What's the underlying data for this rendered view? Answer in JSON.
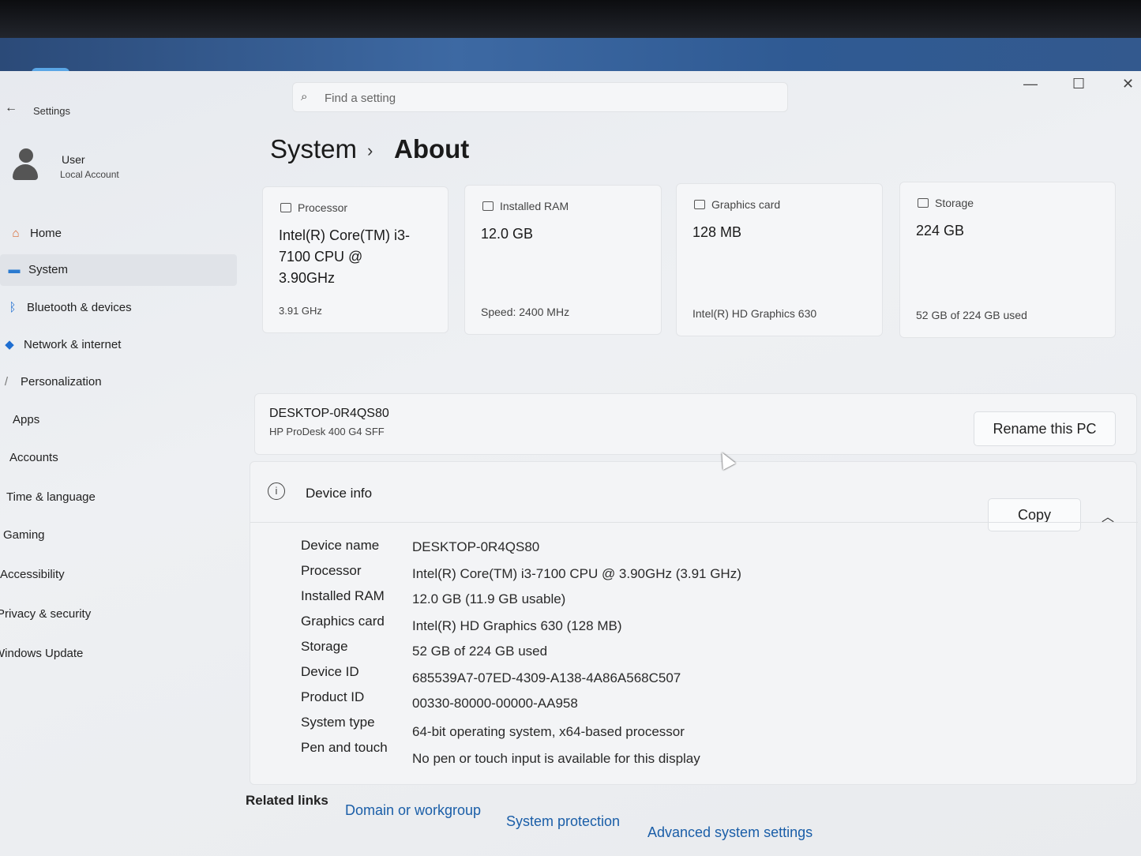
{
  "window": {
    "app_title": "Settings",
    "search_placeholder": "Find a setting",
    "minimize": "—",
    "maximize": "☐",
    "close": "✕"
  },
  "user": {
    "name": "User",
    "account_type": "Local Account"
  },
  "sidebar": {
    "items": [
      {
        "label": "Home",
        "icon": "home-icon"
      },
      {
        "label": "System",
        "icon": "monitor-icon",
        "active": true
      },
      {
        "label": "Bluetooth & devices",
        "icon": "bluetooth-icon"
      },
      {
        "label": "Network & internet",
        "icon": "wifi-icon"
      },
      {
        "label": "Personalization",
        "icon": "brush-icon"
      },
      {
        "label": "Apps",
        "icon": "apps-icon"
      },
      {
        "label": "Accounts",
        "icon": "accounts-icon"
      },
      {
        "label": "Time & language",
        "icon": "clock-icon"
      },
      {
        "label": "Gaming",
        "icon": "gaming-icon"
      },
      {
        "label": "Accessibility",
        "icon": "accessibility-icon"
      },
      {
        "label": "Privacy & security",
        "icon": "shield-icon"
      },
      {
        "label": "Windows Update",
        "icon": "update-icon"
      }
    ]
  },
  "breadcrumb": {
    "parent": "System",
    "separator": "›",
    "current": "About"
  },
  "cards": [
    {
      "label": "Processor",
      "value": "Intel(R) Core(TM) i3-7100 CPU @ 3.90GHz",
      "sub": "3.91 GHz"
    },
    {
      "label": "Installed RAM",
      "value": "12.0 GB",
      "sub": "Speed: 2400 MHz"
    },
    {
      "label": "Graphics card",
      "value": "128 MB",
      "sub": "Intel(R) HD Graphics 630"
    },
    {
      "label": "Storage",
      "value": "224 GB",
      "sub": "52 GB of 224 GB used"
    }
  ],
  "pc": {
    "name": "DESKTOP-0R4QS80",
    "model": "HP ProDesk 400 G4 SFF",
    "rename_label": "Rename this PC"
  },
  "device_info": {
    "title": "Device info",
    "copy_label": "Copy",
    "collapse_icon": "chevron-up-icon",
    "specs": [
      {
        "label": "Device name",
        "value": "DESKTOP-0R4QS80"
      },
      {
        "label": "Processor",
        "value": "Intel(R) Core(TM) i3-7100 CPU @ 3.90GHz (3.91 GHz)"
      },
      {
        "label": "Installed RAM",
        "value": "12.0 GB (11.9 GB usable)"
      },
      {
        "label": "Graphics card",
        "value": "Intel(R) HD Graphics 630 (128 MB)"
      },
      {
        "label": "Storage",
        "value": "52 GB of 224 GB used"
      },
      {
        "label": "Device ID",
        "value": "685539A7-07ED-4309-A138-4A86A568C507"
      },
      {
        "label": "Product ID",
        "value": "00330-80000-00000-AA958"
      },
      {
        "label": "System type",
        "value": "64-bit operating system, x64-based processor"
      },
      {
        "label": "Pen and touch",
        "value": "No pen or touch input is available for this display"
      }
    ]
  },
  "related": {
    "title": "Related links",
    "links": [
      "Domain or workgroup",
      "System protection",
      "Advanced system settings"
    ]
  }
}
